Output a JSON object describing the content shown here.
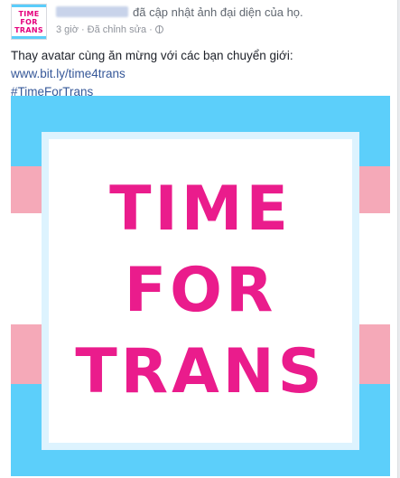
{
  "post": {
    "avatar": {
      "lines": [
        "TIME",
        "FOR",
        "TRANS"
      ]
    },
    "author_blurred": "Trung tâm ICS",
    "action": "đã cập nhật ảnh đại diện của họ.",
    "time": "3 giờ",
    "edited": "Đã chỉnh sửa",
    "privacy_icon": "globe-icon",
    "text": "Thay avatar cùng ăn mừng với các bạn chuyển giới: ",
    "link": "www.bit.ly/time4trans",
    "hashtag": "#TimeForTrans",
    "image": {
      "words": [
        "TIME",
        "FOR",
        "TRANS"
      ]
    }
  },
  "colors": {
    "trans_blue": "#5ccffa",
    "trans_pink": "#f5a9b8",
    "magenta": "#ea1c8c",
    "link": "#365899"
  }
}
